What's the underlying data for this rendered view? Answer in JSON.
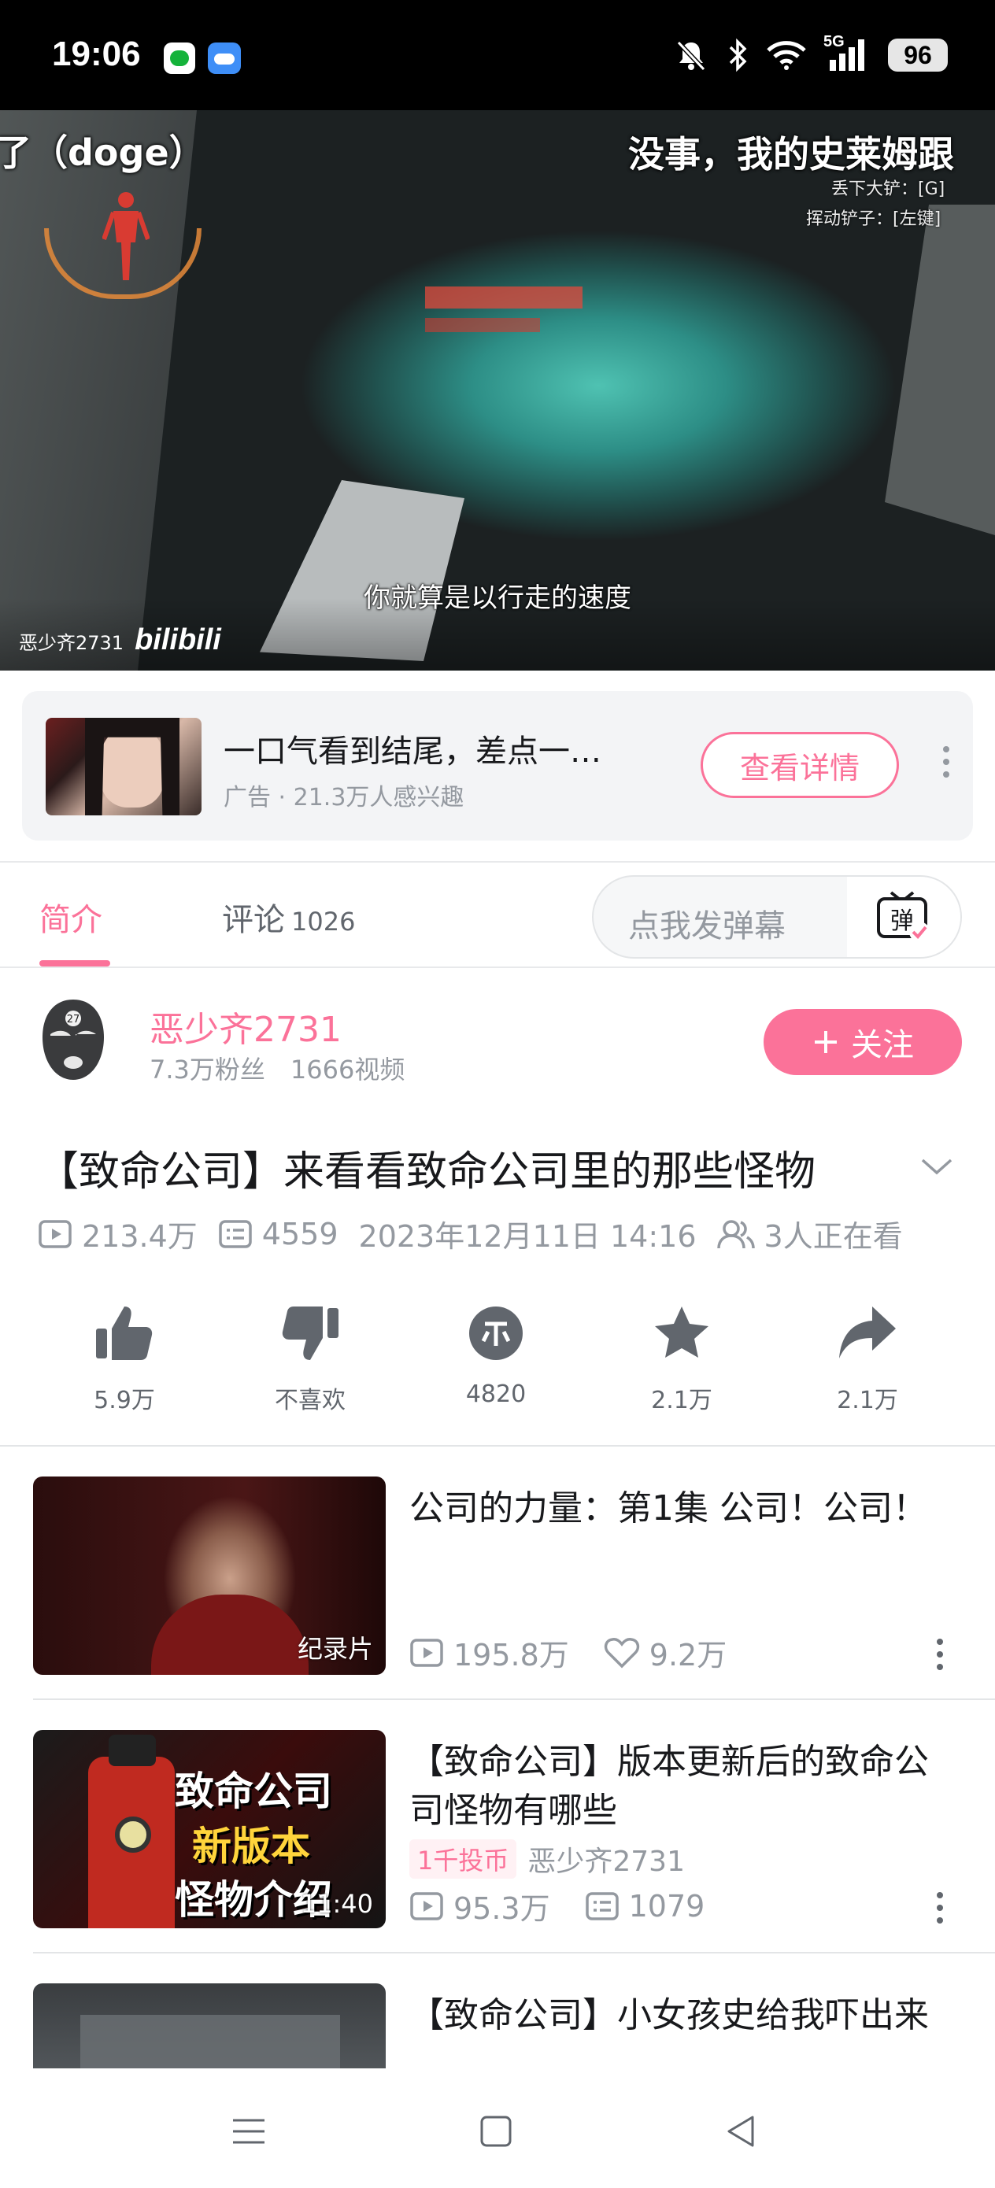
{
  "status_bar": {
    "time": "19:06",
    "battery": "96",
    "network": "5G",
    "app_icons": [
      "green-chat-icon",
      "weather-icon"
    ],
    "right_icons": [
      "mute-bell-icon",
      "bluetooth-icon",
      "wifi-icon",
      "signal-icon",
      "battery-icon"
    ]
  },
  "video": {
    "danmaku_left": "了（doge）",
    "danmaku_right": "没事，我的史莱姆跟",
    "hud_line1": "丢下大铲：[G]",
    "hud_line2": "挥动铲子：[左键]",
    "subtitle": "你就算是以行走的速度",
    "watermark_user": "恶少齐2731",
    "watermark_logo": "bilibili",
    "progress": 0.1
  },
  "ad": {
    "title": "一口气看到结尾，差点一…",
    "subtitle": "广告 · 21.3万人感兴趣",
    "button": "查看详情"
  },
  "tabs": {
    "intro": "简介",
    "comments": "评论",
    "comment_count": "1026",
    "danmaku_placeholder": "点我发弹幕",
    "danmaku_icon_text": "弹"
  },
  "uploader": {
    "name": "恶少齐2731",
    "fans": "7.3万粉丝",
    "videos": "1666视频",
    "follow_label": "关注"
  },
  "video_info": {
    "title": "【致命公司】来看看致命公司里的那些怪物",
    "plays": "213.4万",
    "danmaku": "4559",
    "date": "2023年12月11日 14:16",
    "watching": "3人正在看"
  },
  "actions": {
    "like": "5.9万",
    "dislike": "不喜欢",
    "coin": "4820",
    "favorite": "2.1万",
    "share": "2.1万"
  },
  "recommendations": [
    {
      "title": "公司的力量：第1集 公司！公司！",
      "badge": "纪录片",
      "plays": "195.8万",
      "likes": "9.2万"
    },
    {
      "title": "【致命公司】版本更新后的致命公司怪物有哪些",
      "thumb_text1": "致命公司",
      "thumb_text2": "新版本",
      "thumb_text3": "怪物介绍",
      "badge": "11:40",
      "coin_tag": "1千投币",
      "author": "恶少齐2731",
      "plays": "95.3万",
      "danmaku": "1079"
    },
    {
      "title": "【致命公司】小女孩史给我吓出来"
    }
  ],
  "colors": {
    "accent": "#fb7299",
    "text": "#18191c",
    "secondary": "#9499a0"
  }
}
